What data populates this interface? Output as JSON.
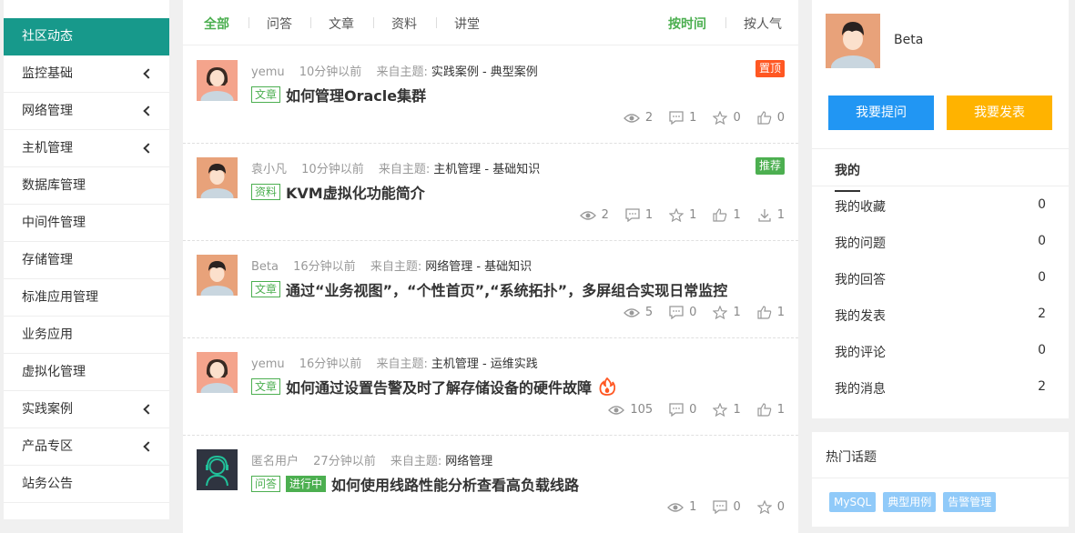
{
  "sidebar": {
    "items": [
      {
        "label": "社区动态",
        "active": true,
        "expandable": false
      },
      {
        "label": "监控基础",
        "expandable": true
      },
      {
        "label": "网络管理",
        "expandable": true
      },
      {
        "label": "主机管理",
        "expandable": true
      },
      {
        "label": "数据库管理",
        "expandable": false
      },
      {
        "label": "中间件管理",
        "expandable": false
      },
      {
        "label": "存储管理",
        "expandable": false
      },
      {
        "label": "标准应用管理",
        "expandable": false
      },
      {
        "label": "业务应用",
        "expandable": false
      },
      {
        "label": "虚拟化管理",
        "expandable": false
      },
      {
        "label": "实践案例",
        "expandable": true
      },
      {
        "label": "产品专区",
        "expandable": true
      },
      {
        "label": "站务公告",
        "expandable": false
      }
    ]
  },
  "feed": {
    "tabs": [
      "全部",
      "问答",
      "文章",
      "资料",
      "讲堂"
    ],
    "active_tab": "全部",
    "sort_tabs": [
      "按时间",
      "按人气"
    ],
    "active_sort": "按时间",
    "from_label": "来自主题:",
    "posts": [
      {
        "author": "yemu",
        "time": "10分钟以前",
        "topic": "实践案例 - 典型案例",
        "tag": "文章",
        "title": "如何管理Oracle集群",
        "badge": "置顶",
        "views": "2",
        "comments": "1",
        "favs": "0",
        "likes": "0"
      },
      {
        "author": "袁小凡",
        "time": "10分钟以前",
        "topic": "主机管理 - 基础知识",
        "tag": "资料",
        "title": "KVM虚拟化功能简介",
        "badge": "推荐",
        "views": "2",
        "comments": "1",
        "favs": "1",
        "likes": "1",
        "downloads": "1"
      },
      {
        "author": "Beta",
        "time": "16分钟以前",
        "topic": "网络管理 - 基础知识",
        "tag": "文章",
        "title": "通过“业务视图”，“个性首页”,“系统拓扑”，多屏组合实现日常监控",
        "views": "5",
        "comments": "0",
        "favs": "1",
        "likes": "1"
      },
      {
        "author": "yemu",
        "time": "16分钟以前",
        "topic": "主机管理 - 运维实践",
        "tag": "文章",
        "title": "如何通过设置告警及时了解存储设备的硬件故障",
        "views": "105",
        "comments": "0",
        "favs": "1",
        "likes": "1"
      },
      {
        "author": "匿名用户",
        "time": "27分钟以前",
        "topic": "网络管理",
        "tag": "问答",
        "tag2": "进行中",
        "title": "如何使用线路性能分析查看高负载线路",
        "views": "1",
        "comments": "0",
        "favs": "0"
      }
    ]
  },
  "profile": {
    "name": "Beta",
    "ask_button": "我要提问",
    "post_button": "我要发表",
    "tab_label": "我的",
    "rows": [
      {
        "label": "我的收藏",
        "count": "0"
      },
      {
        "label": "我的问题",
        "count": "0"
      },
      {
        "label": "我的回答",
        "count": "0"
      },
      {
        "label": "我的发表",
        "count": "2"
      },
      {
        "label": "我的评论",
        "count": "0"
      },
      {
        "label": "我的消息",
        "count": "2"
      }
    ]
  },
  "hot_topics": {
    "title": "热门话题",
    "tags": [
      "MySQL",
      "典型用例",
      "告警管理"
    ]
  },
  "colors": {
    "primary_green": "#17998b",
    "tag_green": "#4caf50",
    "badge_top": "#ff5722",
    "badge_recommend": "#4caf50",
    "ask_blue": "#2196f3",
    "post_orange": "#ffb300",
    "hot_tag": "#90caf9"
  }
}
